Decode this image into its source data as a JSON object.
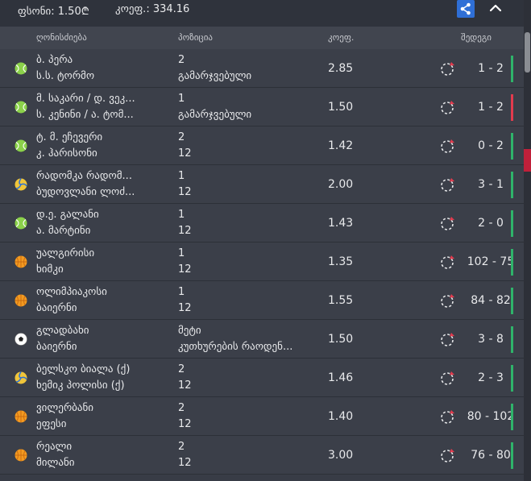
{
  "summary": {
    "stake": "ფსონი: 1.50₾",
    "odds": "კოეფ.: 334.16"
  },
  "icons": {
    "share": "share-icon",
    "collapse": "chevron-up-icon"
  },
  "columns": {
    "event": "ღონისძიება",
    "position": "პოზიცია",
    "odds": "კოეფ.",
    "score": "შედეგი"
  },
  "rows": [
    {
      "sport": "tennis",
      "team1": "ბ. პერა",
      "team2": "ს.ს. ტორმო",
      "pos1": "2",
      "pos2": "გამარჯვებული",
      "odds": "2.85",
      "score": "1 - 2",
      "status": "won"
    },
    {
      "sport": "tennis",
      "team1": "მ. საკარი / დ. ვეკ...",
      "team2": "ს. კენინი / ა. ტომ...",
      "pos1": "1",
      "pos2": "გამარჯვებული",
      "odds": "1.50",
      "score": "1 - 2",
      "status": "lost"
    },
    {
      "sport": "tennis",
      "team1": "ტ. მ. ეჩევერი",
      "team2": "კ. ჰარისონი",
      "pos1": "2",
      "pos2": "12",
      "odds": "1.42",
      "score": "0 - 2",
      "status": "won"
    },
    {
      "sport": "volleyball",
      "team1": "რადომკა რადომ...",
      "team2": "ბუდოვლანი ლოძ...",
      "pos1": "1",
      "pos2": "12",
      "odds": "2.00",
      "score": "3 - 1",
      "status": "won"
    },
    {
      "sport": "tennis",
      "team1": "დ.ე. გალანი",
      "team2": "ა. მარტინი",
      "pos1": "1",
      "pos2": "12",
      "odds": "1.43",
      "score": "2 - 0",
      "status": "won"
    },
    {
      "sport": "basketball",
      "team1": "უალგირისი",
      "team2": "ხიმკი",
      "pos1": "1",
      "pos2": "12",
      "odds": "1.35",
      "score": "102 - 75",
      "status": "won"
    },
    {
      "sport": "basketball",
      "team1": "ოლიმპიაკოსი",
      "team2": "ბაიერნი",
      "pos1": "1",
      "pos2": "12",
      "odds": "1.55",
      "score": "84 - 82",
      "status": "won"
    },
    {
      "sport": "football",
      "team1": "გლადბახი",
      "team2": "ბაიერნი",
      "pos1": "მეტი",
      "pos2": "კუთხურების რაოდენ...",
      "odds": "1.50",
      "score": "3 - 8",
      "status": "won"
    },
    {
      "sport": "volleyball",
      "team1": "ბელსკო ბიალა (ქ)",
      "team2": "ხემიკ პოლისი (ქ)",
      "pos1": "2",
      "pos2": "12",
      "odds": "1.46",
      "score": "2 - 3",
      "status": "won"
    },
    {
      "sport": "basketball",
      "team1": "ვილერბანი",
      "team2": "ეფესი",
      "pos1": "2",
      "pos2": "12",
      "odds": "1.40",
      "score": "80 - 102",
      "status": "won"
    },
    {
      "sport": "basketball",
      "team1": "რეალი",
      "team2": "მილანი",
      "pos1": "2",
      "pos2": "12",
      "odds": "3.00",
      "score": "76 - 80",
      "status": "won"
    }
  ],
  "colors": {
    "won": "#2fb36a",
    "lost": "#e23b4e",
    "accent": "#2f6fd6"
  }
}
